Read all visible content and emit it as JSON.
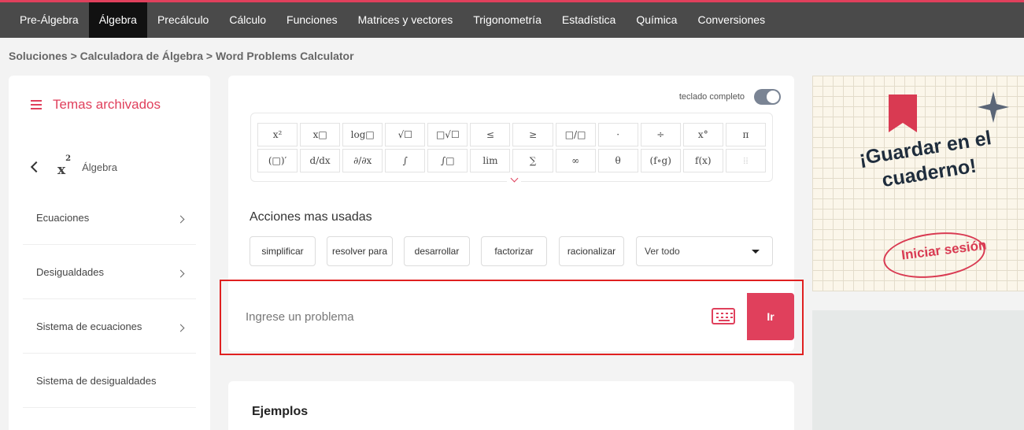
{
  "nav": {
    "items": [
      {
        "label": "Pre-Álgebra",
        "active": false
      },
      {
        "label": "Álgebra",
        "active": true
      },
      {
        "label": "Precálculo",
        "active": false
      },
      {
        "label": "Cálculo",
        "active": false
      },
      {
        "label": "Funciones",
        "active": false
      },
      {
        "label": "Matrices y vectores",
        "active": false
      },
      {
        "label": "Trigonometría",
        "active": false
      },
      {
        "label": "Estadística",
        "active": false
      },
      {
        "label": "Química",
        "active": false
      },
      {
        "label": "Conversiones",
        "active": false
      }
    ]
  },
  "breadcrumb": "Soluciones > Calculadora de Álgebra > Word Problems Calculator",
  "sidebar": {
    "header": "Temas archivados",
    "back_label": "Álgebra",
    "back_icon_base": "x",
    "back_icon_sup": "2",
    "items": [
      {
        "label": "Ecuaciones",
        "has_chevron": true
      },
      {
        "label": "Desigualdades",
        "has_chevron": true
      },
      {
        "label": "Sistema de ecuaciones",
        "has_chevron": true
      },
      {
        "label": "Sistema de desigualdades",
        "has_chevron": false
      }
    ]
  },
  "calculator": {
    "keyboard_toggle_label": "teclado completo",
    "keypad_row1": [
      "x²",
      "x□",
      "log□",
      "√☐",
      "□√☐",
      "≤",
      "≥",
      "□/□",
      "·",
      "÷",
      "x°",
      "π"
    ],
    "keypad_row2": [
      "(□)′",
      "d/dx",
      "∂/∂x",
      "∫",
      "∫□",
      "lim",
      "∑",
      "∞",
      "θ",
      "(f∘g)",
      "f(x)",
      "⁞⁞"
    ],
    "actions_title": "Acciones mas usadas",
    "actions": [
      "simplificar",
      "resolver para",
      "desarrollar",
      "factorizar",
      "racionalizar"
    ],
    "select_value": "Ver todo",
    "input_placeholder": "Ingrese un problema",
    "go_label": "Ir"
  },
  "examples": {
    "title": "Ejemplos"
  },
  "ad": {
    "title": "¡Guardar en el cuaderno!",
    "cta": "Iniciar sesión"
  },
  "colors": {
    "accent": "#e0405c",
    "nav_bg": "#4a4a4a",
    "highlight": "#e02020"
  }
}
